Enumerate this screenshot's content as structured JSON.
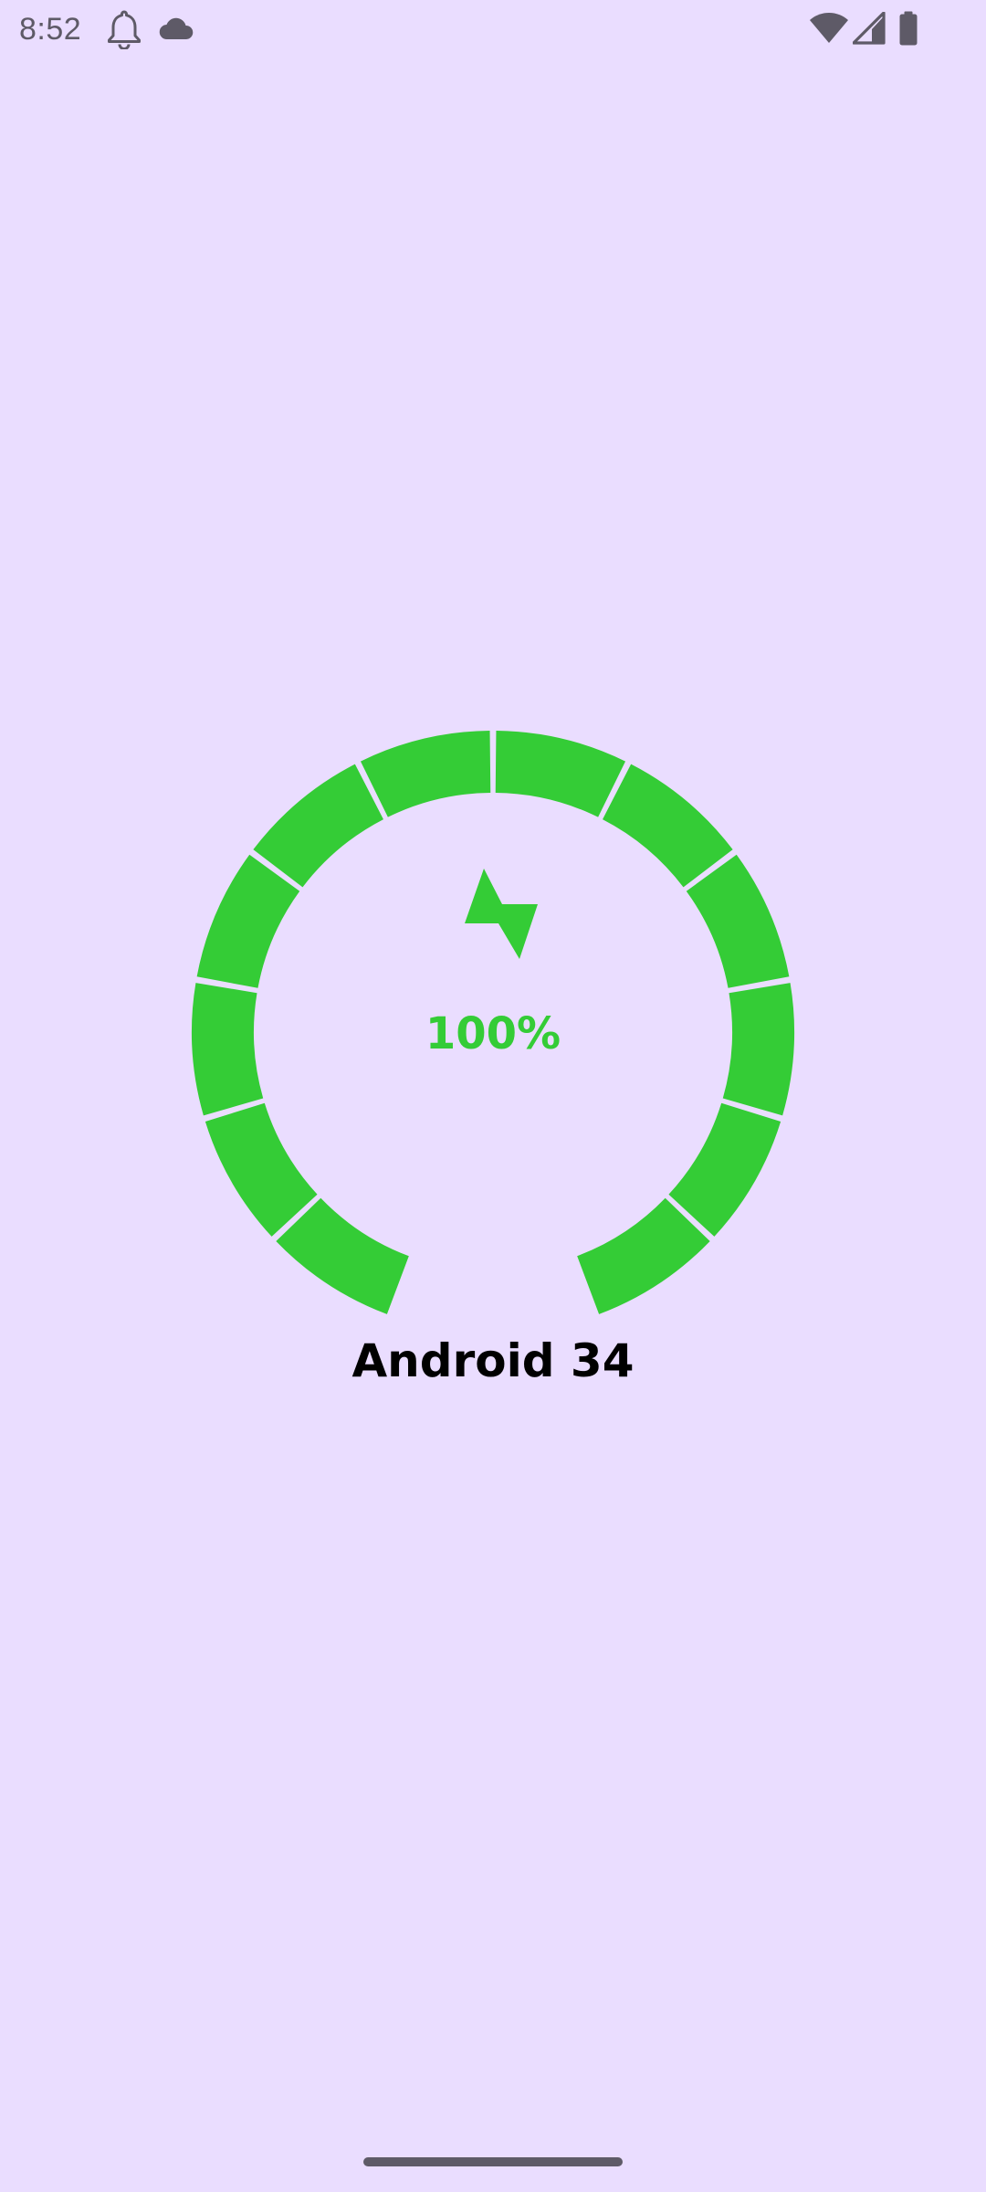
{
  "colors": {
    "background": "#EADDFF",
    "gauge_fill": "#34CC36",
    "status_icons": "#5E5A67",
    "label_text": "#000000"
  },
  "status_bar": {
    "time": "8:52",
    "icons": [
      "bell-icon",
      "cloud-icon",
      "wifi-icon",
      "signal-icon",
      "battery-icon"
    ]
  },
  "battery_gauge": {
    "percent": 100,
    "percent_label": "100%",
    "segment_count": 12,
    "filled_segments": 12,
    "center_icon": "bolt-icon"
  },
  "device": {
    "label": "Android 34"
  }
}
